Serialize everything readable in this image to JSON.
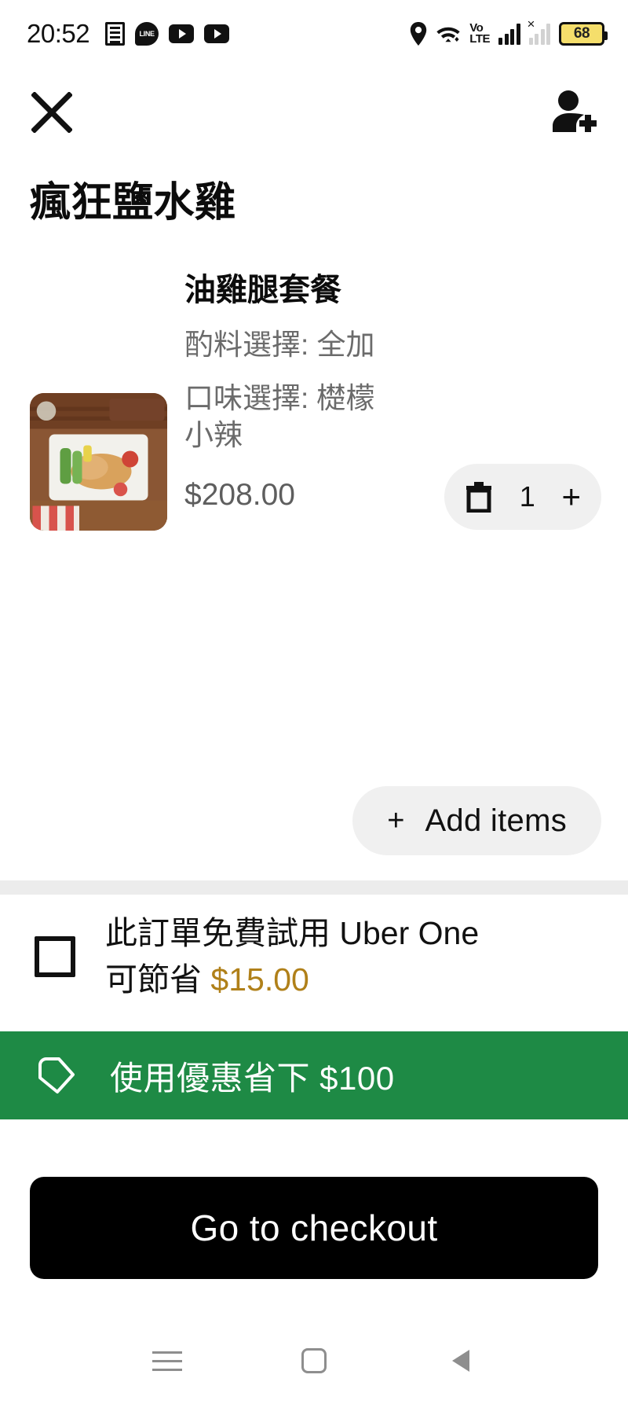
{
  "status_bar": {
    "time": "20:52",
    "left_icons": [
      "news-app-icon",
      "line-app-icon",
      "youtube-app-icon",
      "youtube-app-icon-2"
    ],
    "right_icons": [
      "location-pin-icon",
      "wifi-icon",
      "volte-icon",
      "signal-bars-icon",
      "signal-bars-inactive-icon"
    ],
    "volte_top": "Vo",
    "volte_bottom": "LTE",
    "line_label": "LINE",
    "battery_percent": "68"
  },
  "top_bar": {
    "close_label": "×",
    "close_icon": "close-icon",
    "add_person_icon": "add-person-icon"
  },
  "header": {
    "store_name": "瘋狂鹽水雞"
  },
  "cart": {
    "items": [
      {
        "name": "油雞腿套餐",
        "option_1": "酌料選擇: 全加",
        "option_2": "口味選擇: 檚檬小辣",
        "price": "$208.00",
        "quantity": "1",
        "remove_icon": "trash-icon",
        "increase_label": "+",
        "thumbnail_icon": "food-photo-thumbnail"
      }
    ],
    "add_items": {
      "plus": "+",
      "label": "Add items"
    }
  },
  "uber_one": {
    "checkbox_checked": false,
    "text_prefix": "此訂單免費試用 Uber One 可節省 ",
    "amount": "$15.00",
    "amount_color": "#B08019"
  },
  "promo_banner": {
    "icon": "offer-tag-icon",
    "label": "使用優惠省下 $100",
    "background_color": "#1E8A45",
    "text_color": "#FFFFFF"
  },
  "checkout": {
    "label": "Go to checkout",
    "background_color": "#000000"
  },
  "nav_bar": {
    "recents_icon": "recents-icon",
    "home_icon": "home-icon",
    "back_icon": "back-icon"
  }
}
